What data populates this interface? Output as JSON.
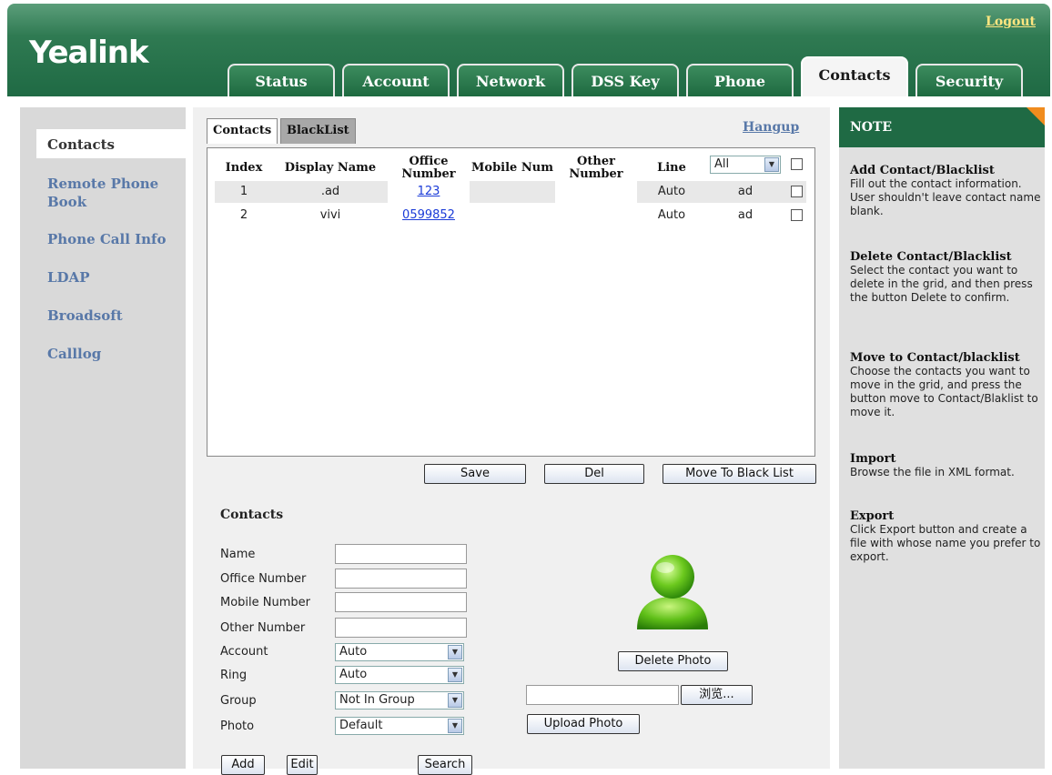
{
  "header": {
    "logo": "Yealink",
    "logout": "Logout",
    "tabs": [
      {
        "label": "Status"
      },
      {
        "label": "Account"
      },
      {
        "label": "Network"
      },
      {
        "label": "DSS Key"
      },
      {
        "label": "Phone"
      },
      {
        "label": "Contacts",
        "active": true
      },
      {
        "label": "Security"
      }
    ]
  },
  "sidebar": {
    "items": [
      {
        "label": "Contacts",
        "active": true
      },
      {
        "label": "Remote Phone Book"
      },
      {
        "label": "Phone Call Info"
      },
      {
        "label": "LDAP"
      },
      {
        "label": "Broadsoft"
      },
      {
        "label": "Calllog"
      }
    ]
  },
  "main": {
    "subtabs": [
      {
        "label": "Contacts",
        "active": true
      },
      {
        "label": "BlackList"
      }
    ],
    "hangup": "Hangup",
    "grid": {
      "columns": [
        "Index",
        "Display Name",
        "Office Number",
        "Mobile Num",
        "Other Number",
        "Line"
      ],
      "line_filter": "All",
      "rows": [
        {
          "index": "1",
          "name": ".ad",
          "office": "123",
          "mobile": "",
          "other": "",
          "line": "Auto",
          "account": "ad"
        },
        {
          "index": "2",
          "name": "vivi",
          "office": "0599852",
          "mobile": "",
          "other": "",
          "line": "Auto",
          "account": "ad"
        }
      ]
    },
    "buttons": {
      "save": "Save",
      "del": "Del",
      "move": "Move To Black List"
    },
    "form": {
      "title": "Contacts",
      "labels": {
        "name": "Name",
        "office": "Office Number",
        "mobile": "Mobile Number",
        "other": "Other Number",
        "account": "Account",
        "ring": "Ring",
        "group": "Group",
        "photo": "Photo"
      },
      "values": {
        "account": "Auto",
        "ring": "Auto",
        "group": "Not In Group",
        "photo": "Default"
      },
      "delete_photo": "Delete Photo",
      "browse": "浏览...",
      "upload_photo": "Upload Photo",
      "add": "Add",
      "edit": "Edit",
      "search": "Search"
    }
  },
  "note": {
    "title": "NOTE",
    "sections": [
      {
        "title": "Add Contact/Blacklist",
        "text": "Fill out the contact information. User shouldn't leave contact name blank."
      },
      {
        "title": "Delete Contact/Blacklist",
        "text": "Select the contact you want to delete in the grid, and then press the button Delete to confirm."
      },
      {
        "title": "Move to Contact/blacklist",
        "text": "Choose the contacts you want to move in the grid, and press the button move to Contact/Blaklist to move it."
      },
      {
        "title": "Import",
        "text": "Browse the file in XML format."
      },
      {
        "title": "Export",
        "text": "Click Export button and create a file with whose name you prefer to export."
      }
    ]
  },
  "colors": {
    "brand_green": "#1f6a44",
    "link_blue": "#5878a8",
    "accent_orange": "#f08c1e"
  }
}
